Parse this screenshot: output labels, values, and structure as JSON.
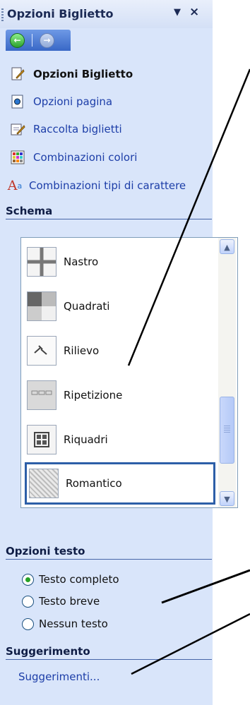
{
  "pane": {
    "title": "Opzioni Biglietto",
    "menu_glyph": "▼",
    "close_glyph": "×",
    "nav": {
      "back_glyph": "←",
      "forward_glyph": "→"
    }
  },
  "tasks": [
    {
      "label": "Opzioni Biglietto",
      "icon": "options-page-icon",
      "bold": true
    },
    {
      "label": "Opzioni pagina",
      "icon": "page-options-icon"
    },
    {
      "label": "Raccolta biglietti",
      "icon": "card-collection-icon"
    },
    {
      "label": "Combinazioni colori",
      "icon": "color-schemes-icon"
    },
    {
      "label": "Combinazioni tipi di carattere",
      "icon": "font-schemes-icon"
    }
  ],
  "font_icon_text": "A",
  "font_icon_super": "a",
  "schema": {
    "heading": "Schema",
    "items": [
      {
        "label": "Nastro",
        "icon": "ribbon-icon"
      },
      {
        "label": "Quadrati",
        "icon": "squares-icon"
      },
      {
        "label": "Rilievo",
        "icon": "relief-icon"
      },
      {
        "label": "Ripetizione",
        "icon": "repeat-icon"
      },
      {
        "label": "Riquadri",
        "icon": "frames-icon"
      },
      {
        "label": "Romantico",
        "icon": "romantic-icon",
        "selected": true
      }
    ],
    "scroll_up": "▲",
    "scroll_down": "▼"
  },
  "text_options": {
    "heading": "Opzioni testo",
    "options": [
      {
        "label": "Testo completo",
        "checked": true
      },
      {
        "label": "Testo breve",
        "checked": false
      },
      {
        "label": "Nessun testo",
        "checked": false
      }
    ]
  },
  "hints": {
    "heading": "Suggerimento",
    "link": "Suggerimenti..."
  },
  "colors": {
    "pane_bg": "#d9e5fa",
    "link": "#1d3ea8",
    "selection": "#2d5fa8",
    "radio_on": "#26a226"
  }
}
